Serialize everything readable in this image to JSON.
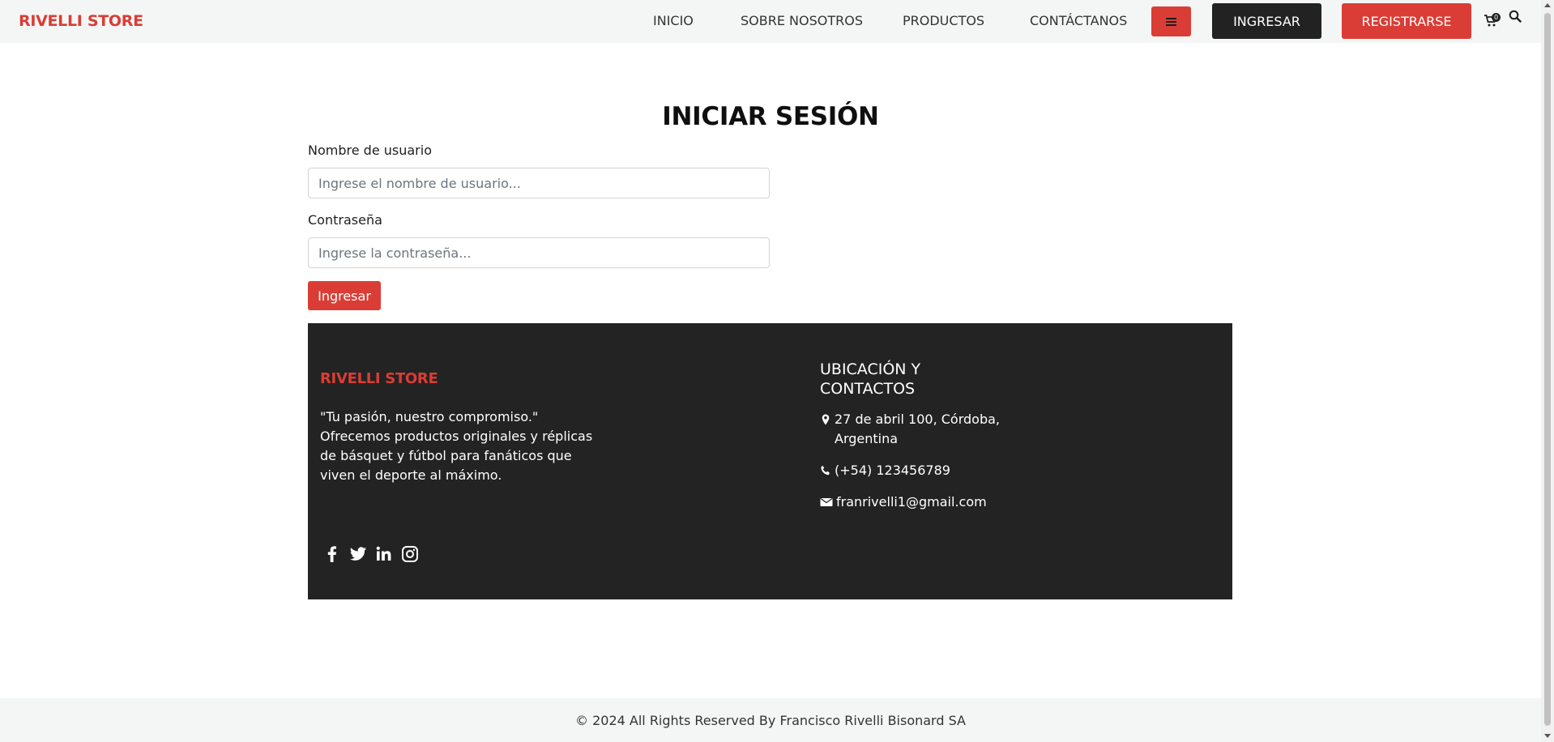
{
  "header": {
    "brand": "RIVELLI STORE",
    "nav": [
      {
        "label": "INICIO"
      },
      {
        "label": "SOBRE NOSOTROS"
      },
      {
        "label": "PRODUCTOS"
      },
      {
        "label": "CONTÁCTANOS"
      }
    ],
    "login_label": "INGRESAR",
    "register_label": "REGISTRARSE",
    "cart_count": "0",
    "icons": {
      "menu": "hamburger-menu-icon",
      "cart": "shopping-cart-icon",
      "search": "search-icon"
    }
  },
  "login": {
    "title": "INICIAR SESIÓN",
    "username_label": "Nombre de usuario",
    "username_placeholder": "Ingrese el nombre de usuario...",
    "username_value": "",
    "password_label": "Contraseña",
    "password_placeholder": "Ingrese la contraseña...",
    "password_value": "",
    "submit_label": "Ingresar"
  },
  "footer": {
    "brand": "RIVELLI STORE",
    "description": "\"Tu pasión, nuestro compromiso.\" Ofrecemos productos originales y réplicas de básquet y fútbol para fanáticos que viven el deporte al máximo.",
    "social_icons": [
      "facebook-icon",
      "twitter-icon",
      "linkedin-icon",
      "instagram-icon"
    ],
    "contact_title": "UBICACIÓN Y CONTACTOS",
    "address": "27 de abril 100, Córdoba, Argentina",
    "phone": "(+54) 123456789",
    "email": "franrivelli1@gmail.com"
  },
  "bottom": {
    "copyright": "© 2024 All Rights Reserved By Francisco Rivelli Bisonard SA"
  },
  "colors": {
    "accent": "#da3d35",
    "dark": "#232323",
    "header_bg": "#f4f6f6"
  }
}
